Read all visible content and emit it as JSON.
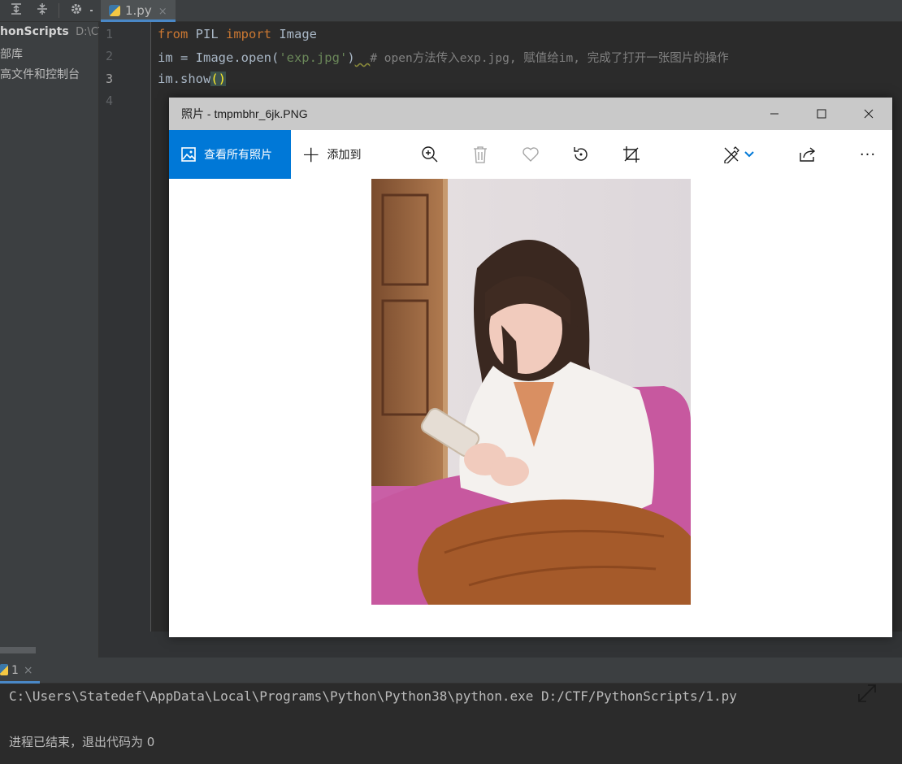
{
  "editor_tab": {
    "label": "1.py",
    "close": "×"
  },
  "project": {
    "root_name": "honScripts",
    "root_path": "D:\\CT",
    "items": [
      "部库",
      "高文件和控制台"
    ]
  },
  "editor": {
    "line_numbers": [
      "1",
      "2",
      "3",
      "4"
    ],
    "line1": {
      "kw_from": "from",
      "module": " PIL ",
      "kw_import": "import",
      "name": " Image"
    },
    "line2": {
      "code": "im = Image.open(",
      "str": "'exp.jpg'",
      "close": ")",
      "squiggle": "  ",
      "comment": "# open方法传入exp.jpg, 赋值给im, 完成了打开一张图片的操作"
    },
    "line3": {
      "code": "im.show",
      "parens": "()"
    }
  },
  "run_panel": {
    "tab_label": "1",
    "tab_close": "×",
    "lines": [
      "C:\\Users\\Statedef\\AppData\\Local\\Programs\\Python\\Python38\\python.exe D:/CTF/PythonScripts/1.py",
      "进程已结束，退出代码为 0"
    ]
  },
  "photos_window": {
    "title": "照片 - tmpmbhr_6jk.PNG",
    "view_all_label": "查看所有照片",
    "add_to_label": "添加到",
    "more_label": "···",
    "accent": "#0078d7"
  }
}
